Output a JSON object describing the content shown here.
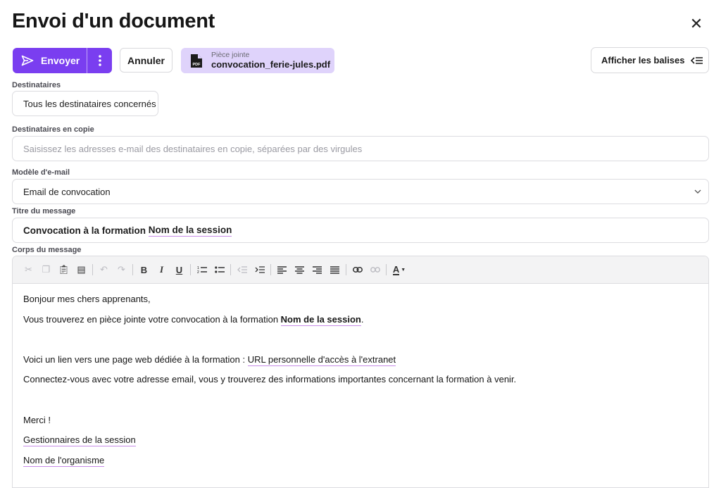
{
  "dialog": {
    "title": "Envoi d'un document",
    "close_icon": "close-icon"
  },
  "actions": {
    "send_label": "Envoyer",
    "cancel_label": "Annuler",
    "attachment": {
      "label": "Pièce jointe",
      "filename": "convocation_ferie-jules.pdf",
      "icon": "pdf-file-icon"
    },
    "show_tags_label": "Afficher les balises"
  },
  "fields": {
    "recipients": {
      "label": "Destinataires",
      "value": "Tous les destinataires concernés"
    },
    "cc": {
      "label": "Destinataires en copie",
      "placeholder": "Saisissez les adresses e-mail des destinataires en copie, séparées par des virgules"
    },
    "template": {
      "label": "Modèle d'e-mail",
      "value": "Email de convocation"
    },
    "subject": {
      "label": "Titre du message",
      "prefix": "Convocation à la formation ",
      "tag": "Nom de la session"
    },
    "body": {
      "label": "Corps du message"
    }
  },
  "editor": {
    "toolbar": [
      "cut",
      "copy",
      "paste",
      "paste-text",
      "undo",
      "redo",
      "bold",
      "italic",
      "underline",
      "ordered-list",
      "bullet-list",
      "outdent",
      "indent",
      "align-left",
      "align-center",
      "align-right",
      "justify",
      "link",
      "unlink",
      "text-color"
    ],
    "lines": {
      "greeting": "Bonjour mes chers apprenants,",
      "line2_prefix": "Vous trouverez en pièce jointe votre convocation à la formation ",
      "line2_tag": "Nom de la session",
      "line2_suffix": ".",
      "line3_prefix": "Voici un lien vers une page web dédiée à la formation : ",
      "line3_tag": "URL personnelle d'accès à l'extranet",
      "line4": "Connectez-vous avec votre adresse email, vous y trouverez des informations importantes concernant la formation à venir.",
      "thanks": "Merci !",
      "sign1": "Gestionnaires de la session",
      "sign2": "Nom de l'organisme"
    }
  },
  "colors": {
    "accent": "#7a3ef0",
    "attachment_bg": "#dfd3fb",
    "tag_underline": "#c78ce8"
  }
}
